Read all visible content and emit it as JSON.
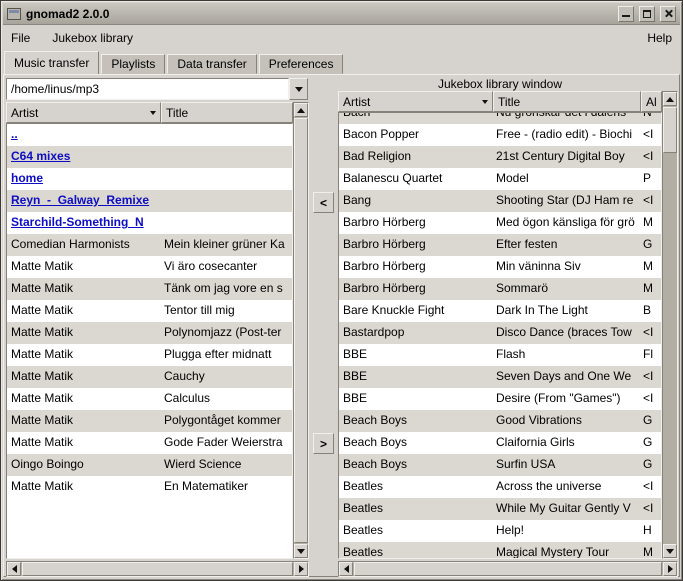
{
  "window": {
    "title": "gnomad2 2.0.0"
  },
  "menu": {
    "file": "File",
    "jukebox_library": "Jukebox library",
    "help": "Help"
  },
  "tabs": [
    "Music transfer",
    "Playlists",
    "Data transfer",
    "Preferences"
  ],
  "local": {
    "path": "/home/linus/mp3",
    "columns": [
      "Artist",
      "Title"
    ],
    "rows": [
      {
        "artist": "..",
        "title": "",
        "dir": true
      },
      {
        "artist": "C64 mixes",
        "title": "",
        "dir": true
      },
      {
        "artist": "home",
        "title": "",
        "dir": true
      },
      {
        "artist": "Reyn_-_Galway_Remixe",
        "title": "",
        "dir": true
      },
      {
        "artist": "Starchild-Something_N",
        "title": "",
        "dir": true
      },
      {
        "artist": "Comedian Harmonists",
        "title": "Mein kleiner grüner Ka"
      },
      {
        "artist": "Matte Matik",
        "title": "Vi äro cosecanter"
      },
      {
        "artist": "Matte Matik",
        "title": "Tänk om jag vore en s"
      },
      {
        "artist": "Matte Matik",
        "title": "Tentor till mig"
      },
      {
        "artist": "Matte Matik",
        "title": "Polynomjazz (Post-ter"
      },
      {
        "artist": "Matte Matik",
        "title": "Plugga efter midnatt"
      },
      {
        "artist": "Matte Matik",
        "title": "Cauchy"
      },
      {
        "artist": "Matte Matik",
        "title": "Calculus"
      },
      {
        "artist": "Matte Matik",
        "title": "Polygontåget kommer"
      },
      {
        "artist": "Matte Matik",
        "title": "Gode Fader Weierstra"
      },
      {
        "artist": "Oingo Boingo",
        "title": "Wierd Science"
      },
      {
        "artist": "Matte Matik",
        "title": "En Matematiker"
      }
    ]
  },
  "transfer": {
    "to_local": "<",
    "to_jukebox": ">"
  },
  "jukebox": {
    "label": "Jukebox library window",
    "columns": [
      "Artist",
      "Title",
      "Al"
    ],
    "rows": [
      {
        "artist": "Bach",
        "title": "Nu grönskar det i dalens",
        "album": "N"
      },
      {
        "artist": "Bacon Popper",
        "title": "Free - (radio edit) - Biochi",
        "album": "<I"
      },
      {
        "artist": "Bad Religion",
        "title": "21st Century Digital Boy",
        "album": "<I"
      },
      {
        "artist": "Balanescu Quartet",
        "title": "Model",
        "album": "P"
      },
      {
        "artist": "Bang",
        "title": "Shooting Star (DJ Ham re",
        "album": "<I"
      },
      {
        "artist": "Barbro Hörberg",
        "title": "Med ögon känsliga för grö",
        "album": "M"
      },
      {
        "artist": "Barbro Hörberg",
        "title": "Efter festen",
        "album": "G"
      },
      {
        "artist": "Barbro Hörberg",
        "title": "Min väninna Siv",
        "album": "M"
      },
      {
        "artist": "Barbro Hörberg",
        "title": "Sommarö",
        "album": "M"
      },
      {
        "artist": "Bare Knuckle Fight",
        "title": "Dark In The Light",
        "album": "B"
      },
      {
        "artist": "Bastardpop",
        "title": "Disco Dance (braces Tow",
        "album": "<I"
      },
      {
        "artist": "BBE",
        "title": "Flash",
        "album": "Fl"
      },
      {
        "artist": "BBE",
        "title": "Seven Days and One We",
        "album": "<I"
      },
      {
        "artist": "BBE",
        "title": "Desire (From \"Games\")",
        "album": "<I"
      },
      {
        "artist": "Beach Boys",
        "title": "Good Vibrations",
        "album": "G"
      },
      {
        "artist": "Beach Boys",
        "title": "Claifornia Girls",
        "album": "G"
      },
      {
        "artist": "Beach Boys",
        "title": "Surfin USA",
        "album": "G"
      },
      {
        "artist": "Beatles",
        "title": "Across the universe",
        "album": "<I"
      },
      {
        "artist": "Beatles",
        "title": "While My Guitar Gently V",
        "album": "<I"
      },
      {
        "artist": "Beatles",
        "title": "Help!",
        "album": "H"
      },
      {
        "artist": "Beatles",
        "title": "Magical Mystery Tour",
        "album": "M"
      }
    ]
  }
}
